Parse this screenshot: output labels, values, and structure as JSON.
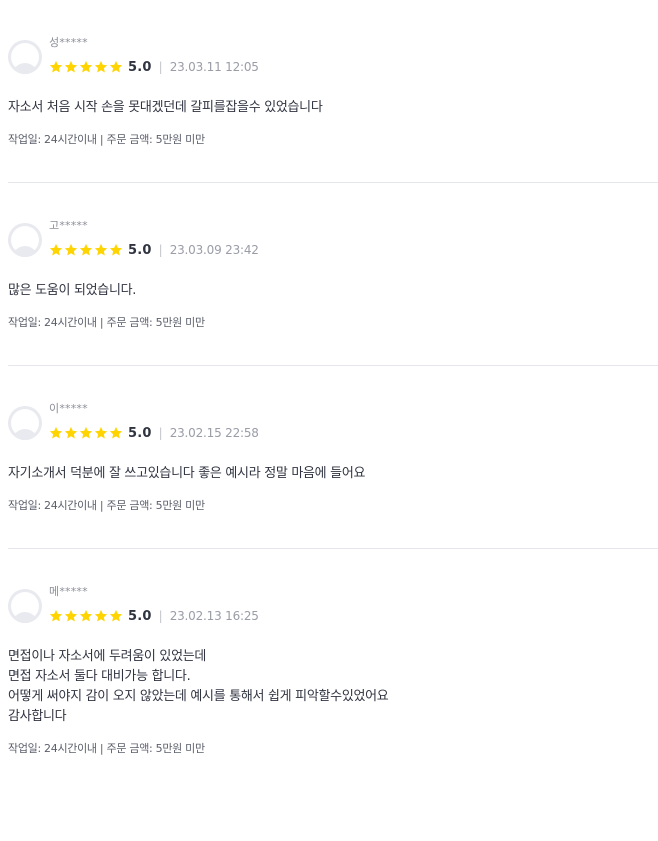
{
  "colors": {
    "star": "#ffd400",
    "divider": "#e4e5ed",
    "text_primary": "#303441",
    "text_muted": "#9a9da7"
  },
  "reviews": [
    {
      "nickname": "성*****",
      "score": "5.0",
      "separator": "|",
      "date": "23.03.11 12:05",
      "text": "자소서 처음 시작 손을 못대겠던데 갈피를잡을수 있었습니다",
      "meta": "작업일: 24시간이내 | 주문 금액: 5만원 미만",
      "stars": 5
    },
    {
      "nickname": "고*****",
      "score": "5.0",
      "separator": "|",
      "date": "23.03.09 23:42",
      "text": "많은 도움이 되었습니다.",
      "meta": "작업일: 24시간이내 | 주문 금액: 5만원 미만",
      "stars": 5
    },
    {
      "nickname": "이*****",
      "score": "5.0",
      "separator": "|",
      "date": "23.02.15 22:58",
      "text": "자기소개서 덕분에 잘 쓰고있습니다 좋은 예시라 정말 마음에 들어요",
      "meta": "작업일: 24시간이내 | 주문 금액: 5만원 미만",
      "stars": 5
    },
    {
      "nickname": "메*****",
      "score": "5.0",
      "separator": "|",
      "date": "23.02.13 16:25",
      "text": "면접이나 자소서에 두려움이 있었는데\n면접 자소서 둘다 대비가능 합니다.\n어떻게 써야지 감이 오지 않았는데 예시를 통해서 쉽게 피악할수있었어요\n감사합니다",
      "meta": "작업일: 24시간이내 | 주문 금액: 5만원 미만",
      "stars": 5
    }
  ]
}
